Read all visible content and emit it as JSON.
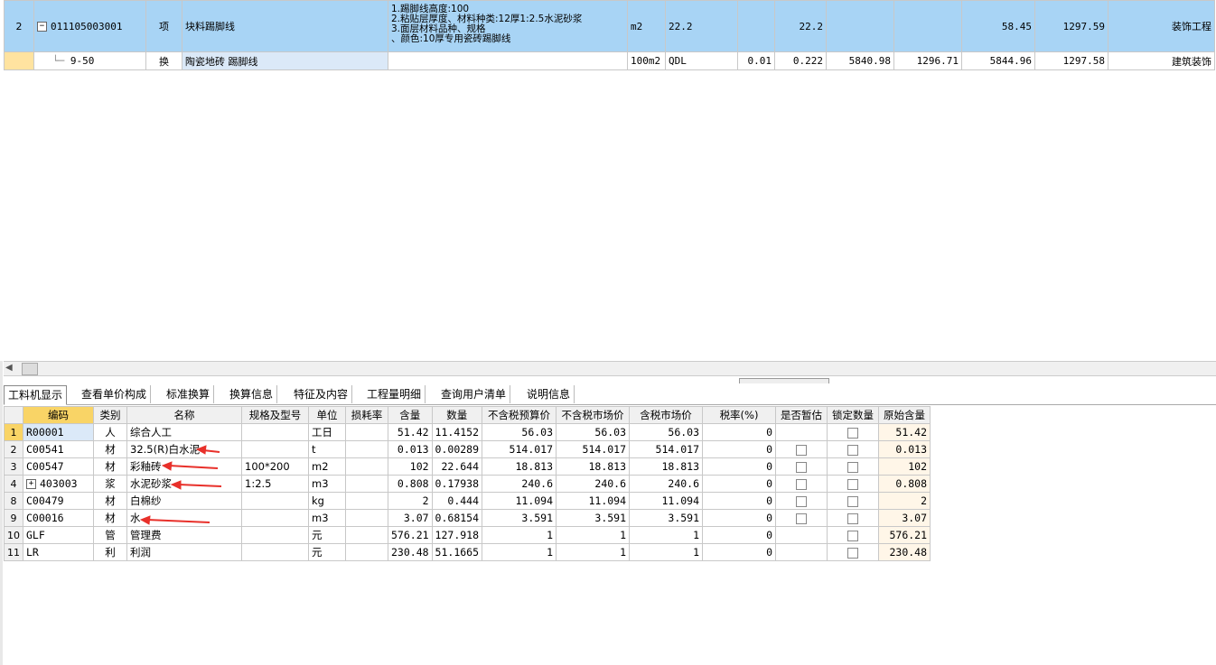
{
  "top_rows": [
    {
      "idx": "2",
      "code": "011105003001",
      "type": "项",
      "name": "块料踢脚线",
      "desc_lines": [
        "1.踢脚线高度:100",
        "2.粘贴层厚度、材料种类:12厚1:2.5水泥砂浆",
        "3.面层材料品种、规格",
        "、颜色:10厚专用瓷砖踢脚线"
      ],
      "unit": "m2",
      "expr": "22.2",
      "c1": "",
      "qty": "22.2",
      "c2": "",
      "c3": "",
      "c4": "58.45",
      "c5": "1297.59",
      "cat": "装饰工程"
    },
    {
      "idx": "",
      "code": "9-50",
      "type": "换",
      "name": "陶瓷地砖 踢脚线",
      "unit": "100m2",
      "expr": "QDL",
      "c1": "0.01",
      "qty": "0.222",
      "c2": "5840.98",
      "c3": "1296.71",
      "c4": "5844.96",
      "c5": "1297.58",
      "cat": "建筑装饰"
    }
  ],
  "tabs": [
    "工料机显示",
    "查看单价构成",
    "标准换算",
    "换算信息",
    "特征及内容",
    "工程量明细",
    "查询用户清单",
    "说明信息"
  ],
  "bottom_headers": [
    "编码",
    "类别",
    "名称",
    "规格及型号",
    "单位",
    "损耗率",
    "含量",
    "数量",
    "不含税预算价",
    "不含税市场价",
    "含税市场价",
    "税率(%)",
    "是否暂估",
    "锁定数量",
    "原始含量"
  ],
  "bottom_rows": [
    {
      "idx": "1",
      "code": "R00001",
      "cat": "人",
      "name": "综合人工",
      "spec": "",
      "unit": "工日",
      "loss": "",
      "content": "51.42",
      "qty": "11.4152",
      "p1": "56.03",
      "p2": "56.03",
      "p3": "56.03",
      "tax": "0",
      "est": false,
      "lock": false,
      "orig": "51.42"
    },
    {
      "idx": "2",
      "code": "C00541",
      "cat": "材",
      "name": "32.5(R)白水泥",
      "spec": "",
      "unit": "t",
      "loss": "",
      "content": "0.013",
      "qty": "0.00289",
      "p1": "514.017",
      "p2": "514.017",
      "p3": "514.017",
      "tax": "0",
      "est": true,
      "lock": true,
      "orig": "0.013"
    },
    {
      "idx": "3",
      "code": "C00547",
      "cat": "材",
      "name": "彩釉砖",
      "spec": "100*200",
      "unit": "m2",
      "loss": "",
      "content": "102",
      "qty": "22.644",
      "p1": "18.813",
      "p2": "18.813",
      "p3": "18.813",
      "tax": "0",
      "est": true,
      "lock": true,
      "orig": "102"
    },
    {
      "idx": "4",
      "code": "403003",
      "cat": "浆",
      "name": "水泥砂浆",
      "spec": "1:2.5",
      "unit": "m3",
      "loss": "",
      "content": "0.808",
      "qty": "0.17938",
      "p1": "240.6",
      "p2": "240.6",
      "p3": "240.6",
      "tax": "0",
      "est": true,
      "lock": true,
      "orig": "0.808"
    },
    {
      "idx": "8",
      "code": "C00479",
      "cat": "材",
      "name": "白棉纱",
      "spec": "",
      "unit": "kg",
      "loss": "",
      "content": "2",
      "qty": "0.444",
      "p1": "11.094",
      "p2": "11.094",
      "p3": "11.094",
      "tax": "0",
      "est": true,
      "lock": true,
      "orig": "2"
    },
    {
      "idx": "9",
      "code": "C00016",
      "cat": "材",
      "name": "水",
      "spec": "",
      "unit": "m3",
      "loss": "",
      "content": "3.07",
      "qty": "0.68154",
      "p1": "3.591",
      "p2": "3.591",
      "p3": "3.591",
      "tax": "0",
      "est": true,
      "lock": true,
      "orig": "3.07"
    },
    {
      "idx": "10",
      "code": "GLF",
      "cat": "管",
      "name": "管理费",
      "spec": "",
      "unit": "元",
      "loss": "",
      "content": "576.21",
      "qty": "127.918",
      "p1": "1",
      "p2": "1",
      "p3": "1",
      "tax": "0",
      "est": false,
      "lock": true,
      "orig": "576.21"
    },
    {
      "idx": "11",
      "code": "LR",
      "cat": "利",
      "name": "利润",
      "spec": "",
      "unit": "元",
      "loss": "",
      "content": "230.48",
      "qty": "51.1665",
      "p1": "1",
      "p2": "1",
      "p3": "1",
      "tax": "0",
      "est": false,
      "lock": true,
      "orig": "230.48"
    }
  ],
  "colors": {
    "selected_row": "#a8d4f5",
    "header_highlight": "#f9d466",
    "arrow": "#e8302a"
  }
}
